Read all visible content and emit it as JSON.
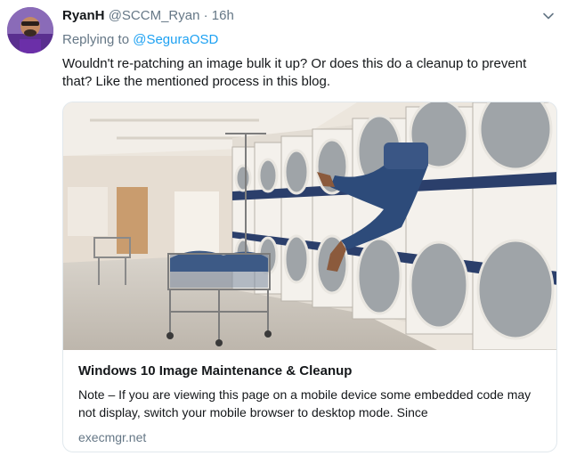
{
  "tweet": {
    "name": "RyanH",
    "handle": "@SCCM_Ryan",
    "separator": "·",
    "time": "16h",
    "replying_prefix": "Replying to ",
    "replying_to": "@SeguraOSD",
    "text": "Wouldn't re-patching an image bulk it up? Or does this do a cleanup to prevent that? Like the mentioned process in this blog.",
    "caret_icon": "chevron-down-icon"
  },
  "card": {
    "title": "Windows 10 Image Maintenance & Cleanup",
    "description": "Note – If you are viewing this page on a mobile device some embedded code may not display, switch your mobile browser to desktop mode.  Since",
    "domain": "execmgr.net"
  },
  "colors": {
    "link": "#1da1f2",
    "secondary_text": "#657786",
    "border": "#e1e8ed"
  }
}
